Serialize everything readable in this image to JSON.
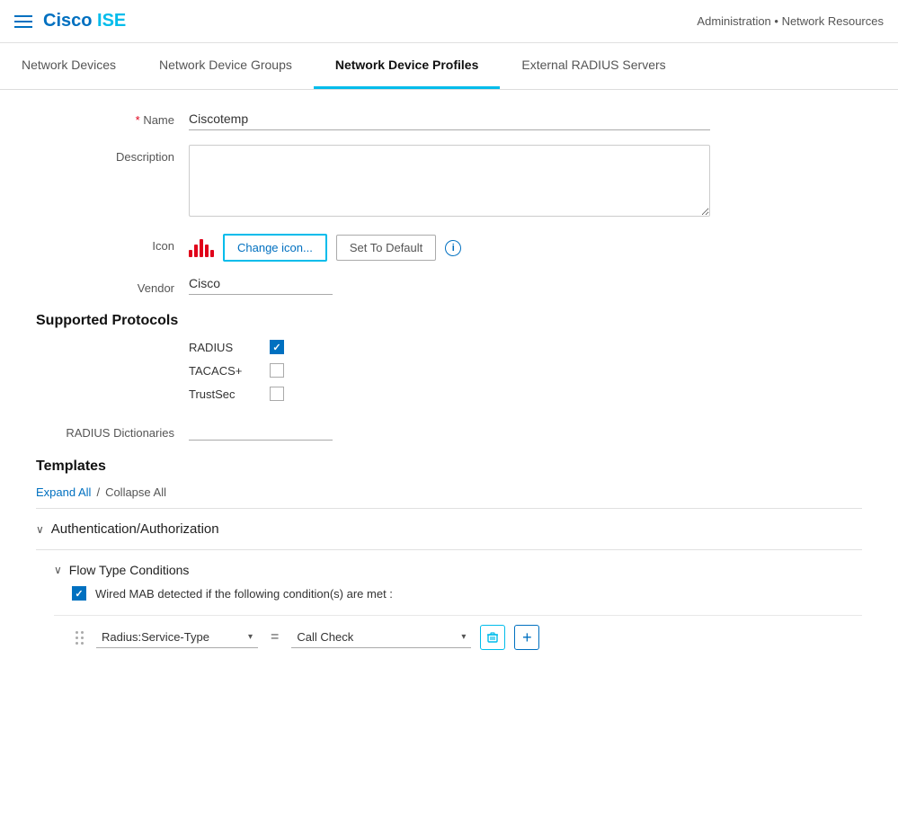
{
  "header": {
    "menu_icon": "hamburger-icon",
    "logo_cisco": "Cisco",
    "logo_ise": "ISE",
    "breadcrumb": "Administration • Network Resources"
  },
  "nav": {
    "tabs": [
      {
        "id": "network-devices",
        "label": "Network Devices",
        "active": false
      },
      {
        "id": "network-device-groups",
        "label": "Network Device Groups",
        "active": false
      },
      {
        "id": "network-device-profiles",
        "label": "Network Device Profiles",
        "active": true
      },
      {
        "id": "external-radius-servers",
        "label": "External RADIUS Servers",
        "active": false
      }
    ]
  },
  "form": {
    "name_label": "* Name",
    "name_required_marker": "*",
    "name_field_label": "Name",
    "name_value": "Ciscotemp",
    "description_label": "Description",
    "description_value": "",
    "description_placeholder": "",
    "icon_label": "Icon",
    "change_icon_btn": "Change icon...",
    "set_to_default_btn": "Set To Default",
    "vendor_label": "Vendor",
    "vendor_value": "Cisco",
    "protocols_section_title": "Supported Protocols",
    "protocols": [
      {
        "id": "radius",
        "label": "RADIUS",
        "checked": true
      },
      {
        "id": "tacacs",
        "label": "TACACS+",
        "checked": false
      },
      {
        "id": "trustsec",
        "label": "TrustSec",
        "checked": false
      }
    ],
    "radius_dict_label": "RADIUS Dictionaries",
    "radius_dict_value": ""
  },
  "templates": {
    "section_title": "Templates",
    "expand_all_label": "Expand All",
    "separator": "/",
    "collapse_all_label": "Collapse All",
    "sections": [
      {
        "id": "auth-authz",
        "label": "Authentication/Authorization",
        "expanded": false,
        "chevron": "∨"
      },
      {
        "id": "flow-type",
        "label": "Flow Type Conditions",
        "expanded": true,
        "chevron": "∨",
        "sub_items": [
          {
            "id": "wired-mab",
            "label": "Wired MAB detected if the following condition(s) are met :",
            "checked": true,
            "conditions": [
              {
                "id": "condition-1",
                "left_dropdown_value": "Radius:Service-Type",
                "operator": "=",
                "right_dropdown_value": "Call Check"
              }
            ]
          }
        ]
      }
    ]
  }
}
